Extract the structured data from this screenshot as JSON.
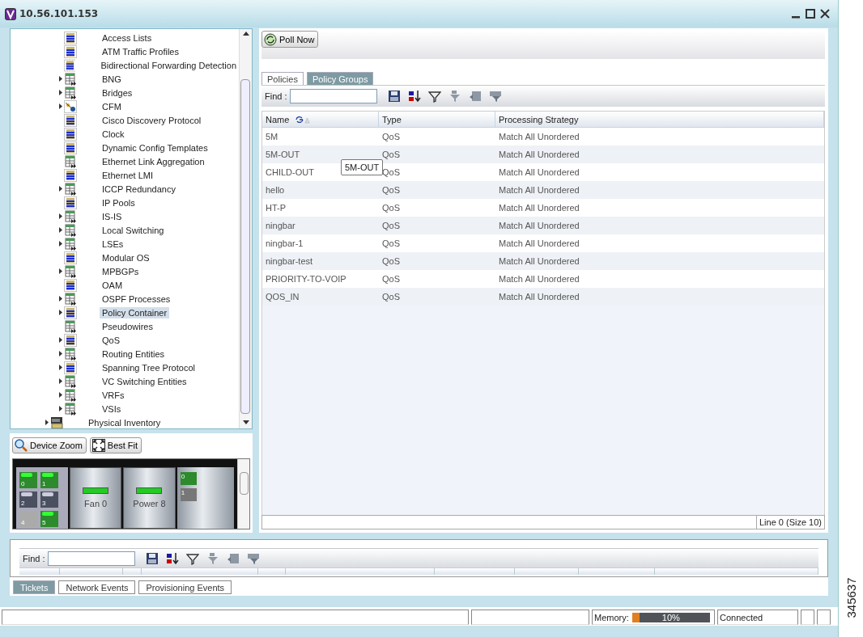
{
  "window": {
    "title": "10.56.101.153"
  },
  "tree": {
    "children": [
      {
        "label": "Access Lists",
        "kind": "config",
        "expandable": false,
        "selected": false
      },
      {
        "label": "ATM Traffic Profiles",
        "kind": "config",
        "expandable": false,
        "selected": false
      },
      {
        "label": "Bidirectional Forwarding Detection",
        "kind": "config",
        "expandable": false,
        "selected": false
      },
      {
        "label": "BNG",
        "kind": "table",
        "expandable": true,
        "selected": false
      },
      {
        "label": "Bridges",
        "kind": "table",
        "expandable": true,
        "selected": false
      },
      {
        "label": "CFM",
        "kind": "cfm",
        "expandable": true,
        "selected": false
      },
      {
        "label": "Cisco Discovery Protocol",
        "kind": "config",
        "expandable": false,
        "selected": false
      },
      {
        "label": "Clock",
        "kind": "config",
        "expandable": false,
        "selected": false
      },
      {
        "label": "Dynamic Config Templates",
        "kind": "config",
        "expandable": false,
        "selected": false
      },
      {
        "label": "Ethernet Link Aggregation",
        "kind": "table",
        "expandable": false,
        "selected": false
      },
      {
        "label": "Ethernet LMI",
        "kind": "config",
        "expandable": false,
        "selected": false
      },
      {
        "label": "ICCP Redundancy",
        "kind": "table",
        "expandable": true,
        "selected": false
      },
      {
        "label": "IP Pools",
        "kind": "config",
        "expandable": false,
        "selected": false
      },
      {
        "label": "IS-IS",
        "kind": "table",
        "expandable": true,
        "selected": false
      },
      {
        "label": "Local Switching",
        "kind": "table",
        "expandable": true,
        "selected": false
      },
      {
        "label": "LSEs",
        "kind": "table",
        "expandable": true,
        "selected": false
      },
      {
        "label": "Modular OS",
        "kind": "config",
        "expandable": false,
        "selected": false
      },
      {
        "label": "MPBGPs",
        "kind": "table",
        "expandable": true,
        "selected": false
      },
      {
        "label": "OAM",
        "kind": "config",
        "expandable": false,
        "selected": false
      },
      {
        "label": "OSPF Processes",
        "kind": "table",
        "expandable": true,
        "selected": false
      },
      {
        "label": "Policy Container",
        "kind": "config",
        "expandable": true,
        "selected": true
      },
      {
        "label": "Pseudowires",
        "kind": "table",
        "expandable": false,
        "selected": false
      },
      {
        "label": "QoS",
        "kind": "config",
        "expandable": true,
        "selected": false
      },
      {
        "label": "Routing Entities",
        "kind": "table",
        "expandable": true,
        "selected": false
      },
      {
        "label": "Spanning Tree Protocol",
        "kind": "config",
        "expandable": true,
        "selected": false
      },
      {
        "label": "VC Switching Entities",
        "kind": "table",
        "expandable": true,
        "selected": false
      },
      {
        "label": "VRFs",
        "kind": "table",
        "expandable": true,
        "selected": false
      },
      {
        "label": "VSIs",
        "kind": "table",
        "expandable": true,
        "selected": false
      }
    ],
    "root_siblings": [
      {
        "label": "Physical Inventory",
        "kind": "inventory",
        "expandable": true,
        "selected": false
      }
    ]
  },
  "device_view": {
    "buttons": [
      "Device Zoom",
      "Best Fit"
    ],
    "ports": [
      {
        "label": "0",
        "kind": "up"
      },
      {
        "label": "1",
        "kind": "up"
      },
      {
        "label": "2",
        "kind": "down"
      },
      {
        "label": "3",
        "kind": "down"
      },
      {
        "label": "4",
        "kind": "empty"
      },
      {
        "label": "5",
        "kind": "up"
      }
    ],
    "modules": [
      "Fan 0",
      "Power 8"
    ],
    "slots": [
      {
        "label": "0",
        "kind": "up"
      },
      {
        "label": "1",
        "kind": "down"
      }
    ]
  },
  "policy_panel": {
    "poll_button": "Poll Now",
    "tabs": [
      {
        "label": "Policies",
        "selected": false
      },
      {
        "label": "Policy Groups",
        "selected": true
      }
    ],
    "find_label": "Find :",
    "columns": [
      "Name",
      "Type",
      "Processing Strategy"
    ],
    "rows": [
      [
        "5M",
        "QoS",
        "Match All Unordered"
      ],
      [
        "5M-OUT",
        "QoS",
        "Match All Unordered"
      ],
      [
        "CHILD-OUT",
        "QoS",
        "Match All Unordered"
      ],
      [
        "hello",
        "QoS",
        "Match All Unordered"
      ],
      [
        "HT-P",
        "QoS",
        "Match All Unordered"
      ],
      [
        "ningbar",
        "QoS",
        "Match All Unordered"
      ],
      [
        "ningbar-1",
        "QoS",
        "Match All Unordered"
      ],
      [
        "ningbar-test",
        "QoS",
        "Match All Unordered"
      ],
      [
        "PRIORITY-TO-VOIP",
        "QoS",
        "Match All Unordered"
      ],
      [
        "QOS_IN",
        "QoS",
        "Match All Unordered"
      ]
    ],
    "tooltip": "5M-OUT",
    "line_status": "Line 0 (Size 10)"
  },
  "events_panel": {
    "find_label": "Find :",
    "tabs": [
      {
        "label": "Tickets",
        "selected": true
      },
      {
        "label": "Network Events",
        "selected": false
      },
      {
        "label": "Provisioning Events",
        "selected": false
      }
    ]
  },
  "status_bar": {
    "memory_label": "Memory:",
    "memory": {
      "level": 0.1,
      "reading": "10%"
    },
    "connection": "Connected"
  },
  "figure_number": "345637"
}
